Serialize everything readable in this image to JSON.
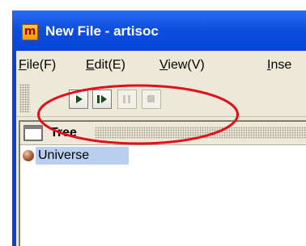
{
  "window": {
    "app_icon_glyph": "m",
    "title": "New File - artisoc"
  },
  "menubar": {
    "items": [
      {
        "mnemonic": "F",
        "label": "ile(F)"
      },
      {
        "mnemonic": "E",
        "label": "dit(E)"
      },
      {
        "mnemonic": "V",
        "label": "iew(V)"
      },
      {
        "mnemonic": "I",
        "label": "nse"
      }
    ]
  },
  "toolbar": {
    "buttons": [
      {
        "name": "run",
        "icon": "play-icon",
        "enabled": true
      },
      {
        "name": "step",
        "icon": "step-icon",
        "enabled": true
      },
      {
        "name": "pause",
        "icon": "pause-icon",
        "enabled": false
      },
      {
        "name": "stop",
        "icon": "stop-icon",
        "enabled": false
      }
    ]
  },
  "tree_panel": {
    "title": "Tree",
    "nodes": [
      {
        "label": "Universe",
        "icon": "sphere-icon",
        "selected": true
      }
    ]
  },
  "annotation": {
    "shape": "ellipse",
    "color": "#e0101c"
  },
  "colors": {
    "titlebar": "#0e4fe0",
    "selection": "#b8cff0",
    "run_icon": "#1b4d1b"
  }
}
